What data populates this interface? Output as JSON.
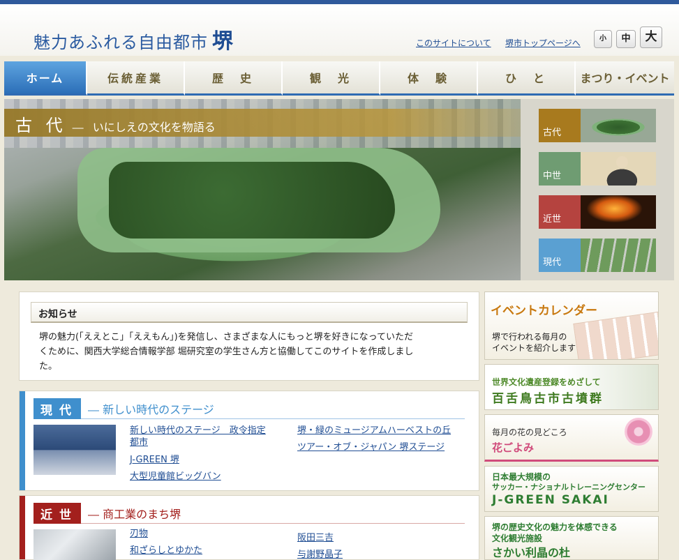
{
  "header": {
    "title_main": "魅力あふれる自由都市",
    "title_big": "堺",
    "link_about": "このサイトについて",
    "link_top": "堺市トップページへ",
    "font_small": "小",
    "font_medium": "中",
    "font_large": "大"
  },
  "nav": [
    "ホーム",
    "伝統産業",
    "歴　史",
    "観　光",
    "体　験",
    "ひ　と",
    "まつり・イベント"
  ],
  "hero": {
    "era": "古 代",
    "dash": "―",
    "caption": "いにしえの文化を物語る"
  },
  "thumbs": [
    {
      "label": "古代",
      "color": "#a87a1e"
    },
    {
      "label": "中世",
      "color": "#6f9c72"
    },
    {
      "label": "近世",
      "color": "#b5433f"
    },
    {
      "label": "現代",
      "color": "#5aa0d2"
    }
  ],
  "notice": {
    "heading": "お知らせ",
    "line1": "堺の魅力(「ええとこ」「ええもん」)を発信し、さまざまな人にもっと堺を好きになっていただ",
    "line2": "くために、関西大学総合情報学部 堀研究室の学生さん方と協働してこのサイトを作成しまし",
    "line3": "た。"
  },
  "eras": {
    "gendai": {
      "tag": "現代",
      "sub": "― 新しい時代のステージ",
      "color": "#3f8fcd",
      "links_left": [
        "新しい時代のステージ　政令指定",
        "都市",
        "J-GREEN 堺",
        "大型児童館ビッグバン"
      ],
      "links_right": [
        "堺・緑のミュージアムハーベストの丘",
        "ツアー・オブ・ジャパン 堺ステージ"
      ]
    },
    "kinsei": {
      "tag": "近世",
      "sub": "― 商工業のまち堺",
      "color": "#a3201d",
      "links_left": [
        "刃物",
        "和ざらしとゆかた"
      ],
      "links_right": [
        "阪田三吉",
        "与謝野晶子"
      ]
    }
  },
  "side": {
    "calendar_title": "イベントカレンダー",
    "calendar_line1": "堺で行われる毎月の",
    "calendar_line2": "イベントを紹介します",
    "heritage_line1": "世界文化遺産登録をめざして",
    "heritage_line2": "百舌鳥古市古墳群",
    "flower_line1": "毎月の花の見どころ",
    "flower_line2": "花ごよみ",
    "jgreen_line1": "日本最大規模の",
    "jgreen_line2": "サッカー・ナショナルトレーニングセンター",
    "jgreen_line3": "J-GREEN SAKAI",
    "rishou_line1": "堺の歴史文化の魅力を体感できる",
    "rishou_line2": "文化観光施設",
    "rishou_line3": "さかい利晶の杜"
  }
}
